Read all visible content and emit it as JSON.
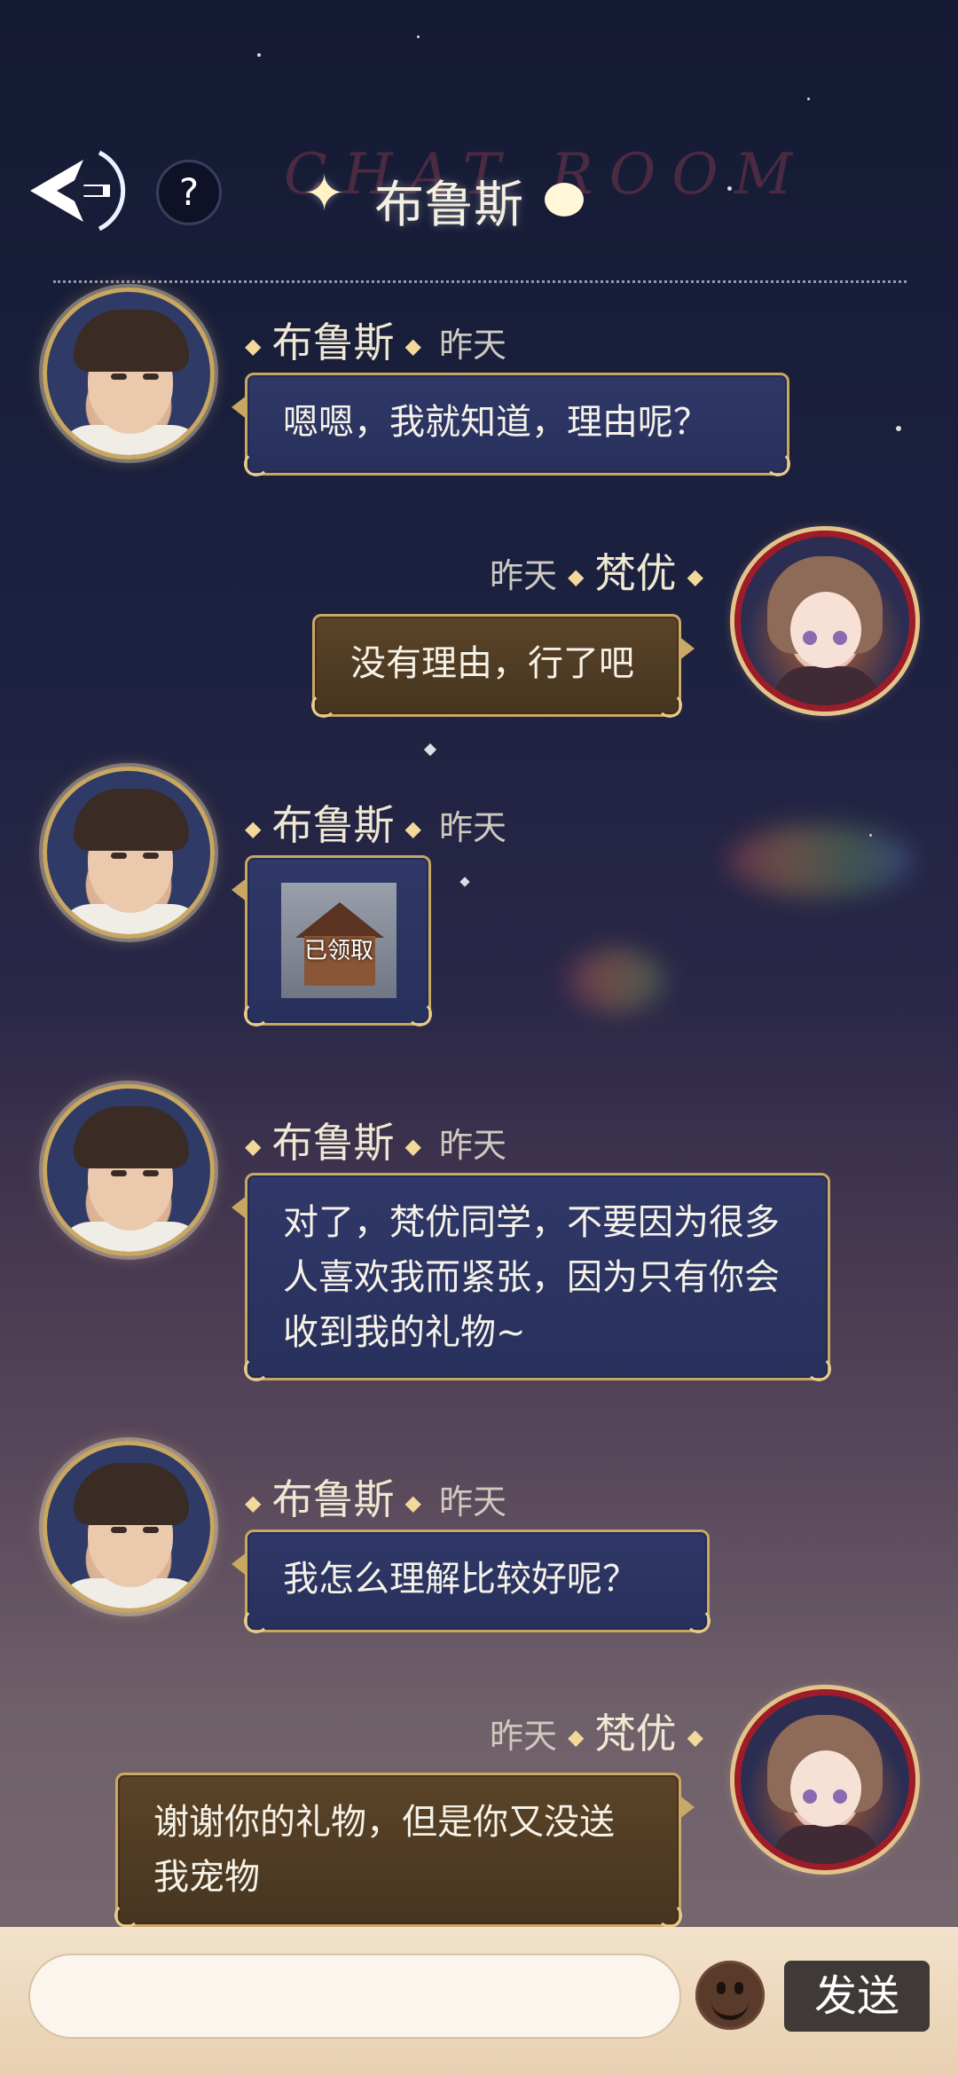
{
  "header": {
    "bg_word": "CHAT ROOM",
    "title": "布鲁斯",
    "help_label": "?"
  },
  "messages": [
    {
      "sender": "布鲁斯",
      "time": "昨天",
      "text": "嗯嗯，我就知道，理由呢？"
    },
    {
      "sender": "梵优",
      "time": "昨天",
      "text": "没有理由，行了吧"
    },
    {
      "sender": "布鲁斯",
      "time": "昨天",
      "gift_label": "已领取"
    },
    {
      "sender": "布鲁斯",
      "time": "昨天",
      "text": "对了，梵优同学，不要因为很多人喜欢我而紧张，因为只有你会收到我的礼物~"
    },
    {
      "sender": "布鲁斯",
      "time": "昨天",
      "text": "我怎么理解比较好呢？"
    },
    {
      "sender": "梵优",
      "time": "昨天",
      "text": "谢谢你的礼物，但是你又没送我宠物"
    }
  ],
  "input": {
    "value": "",
    "placeholder": "",
    "send_label": "发送"
  },
  "icons": {
    "back": "back-arrow-icon",
    "help": "help-icon",
    "emoji": "emoji-icon"
  },
  "colors": {
    "bubble_left": "#2f3868",
    "bubble_right": "#5b4428",
    "gold_border": "#c8a763",
    "send_button": "#3f3a37"
  }
}
